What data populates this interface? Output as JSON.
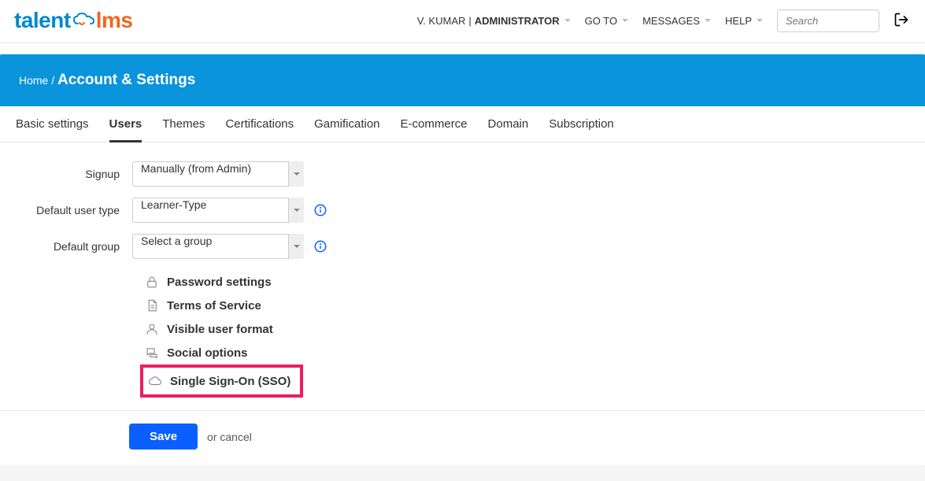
{
  "header": {
    "user_name": "V. KUMAR",
    "user_role": "ADMINISTRATOR",
    "nav": {
      "goto": "GO TO",
      "messages": "MESSAGES",
      "help": "HELP"
    },
    "search_placeholder": "Search"
  },
  "page": {
    "breadcrumb_home": "Home",
    "breadcrumb_sep": " / ",
    "title": "Account & Settings"
  },
  "tabs": [
    {
      "label": "Basic settings",
      "active": false
    },
    {
      "label": "Users",
      "active": true
    },
    {
      "label": "Themes",
      "active": false
    },
    {
      "label": "Certifications",
      "active": false
    },
    {
      "label": "Gamification",
      "active": false
    },
    {
      "label": "E-commerce",
      "active": false
    },
    {
      "label": "Domain",
      "active": false
    },
    {
      "label": "Subscription",
      "active": false
    }
  ],
  "form": {
    "signup": {
      "label": "Signup",
      "value": "Manually (from Admin)"
    },
    "default_user_type": {
      "label": "Default user type",
      "value": "Learner-Type"
    },
    "default_group": {
      "label": "Default group",
      "value": "Select a group"
    }
  },
  "links": {
    "password": "Password settings",
    "tos": "Terms of Service",
    "visible_user_format": "Visible user format",
    "social": "Social options",
    "sso": "Single Sign-On (SSO)"
  },
  "actions": {
    "save": "Save",
    "or": "or ",
    "cancel": "cancel"
  }
}
